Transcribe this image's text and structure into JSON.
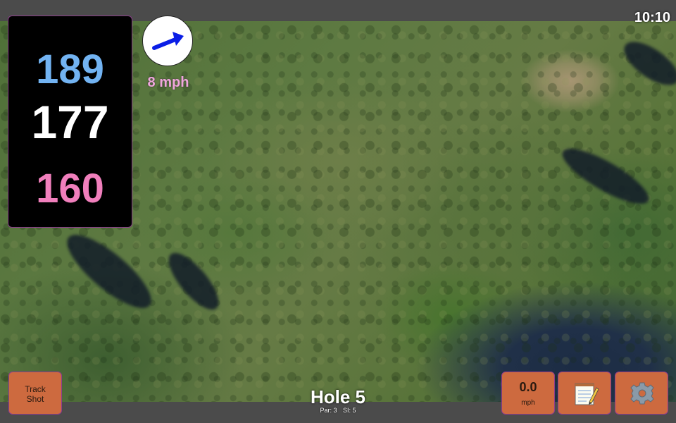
{
  "status_bar": {
    "time": "10:10"
  },
  "yardages": {
    "back": "189",
    "middle": "177",
    "front": "160"
  },
  "wind": {
    "speed": "8 mph",
    "icon": "wind-arrow-icon",
    "arrow_color": "#0a1ee6"
  },
  "hole": {
    "title": "Hole 5",
    "par": "Par: 3",
    "si": "SI: 5"
  },
  "buttons": {
    "track_shot_line1": "Track",
    "track_shot_line2": "Shot",
    "speed_value": "0.0",
    "speed_unit": "mph",
    "notes_icon": "notepad-icon",
    "settings_icon": "gear-icon"
  },
  "colors": {
    "button_bg": "#cd6a3f",
    "back_color": "#72b3f2",
    "middle_color": "#ffffff",
    "front_color": "#f07fbc",
    "wind_text_color": "#f0a6dc"
  }
}
